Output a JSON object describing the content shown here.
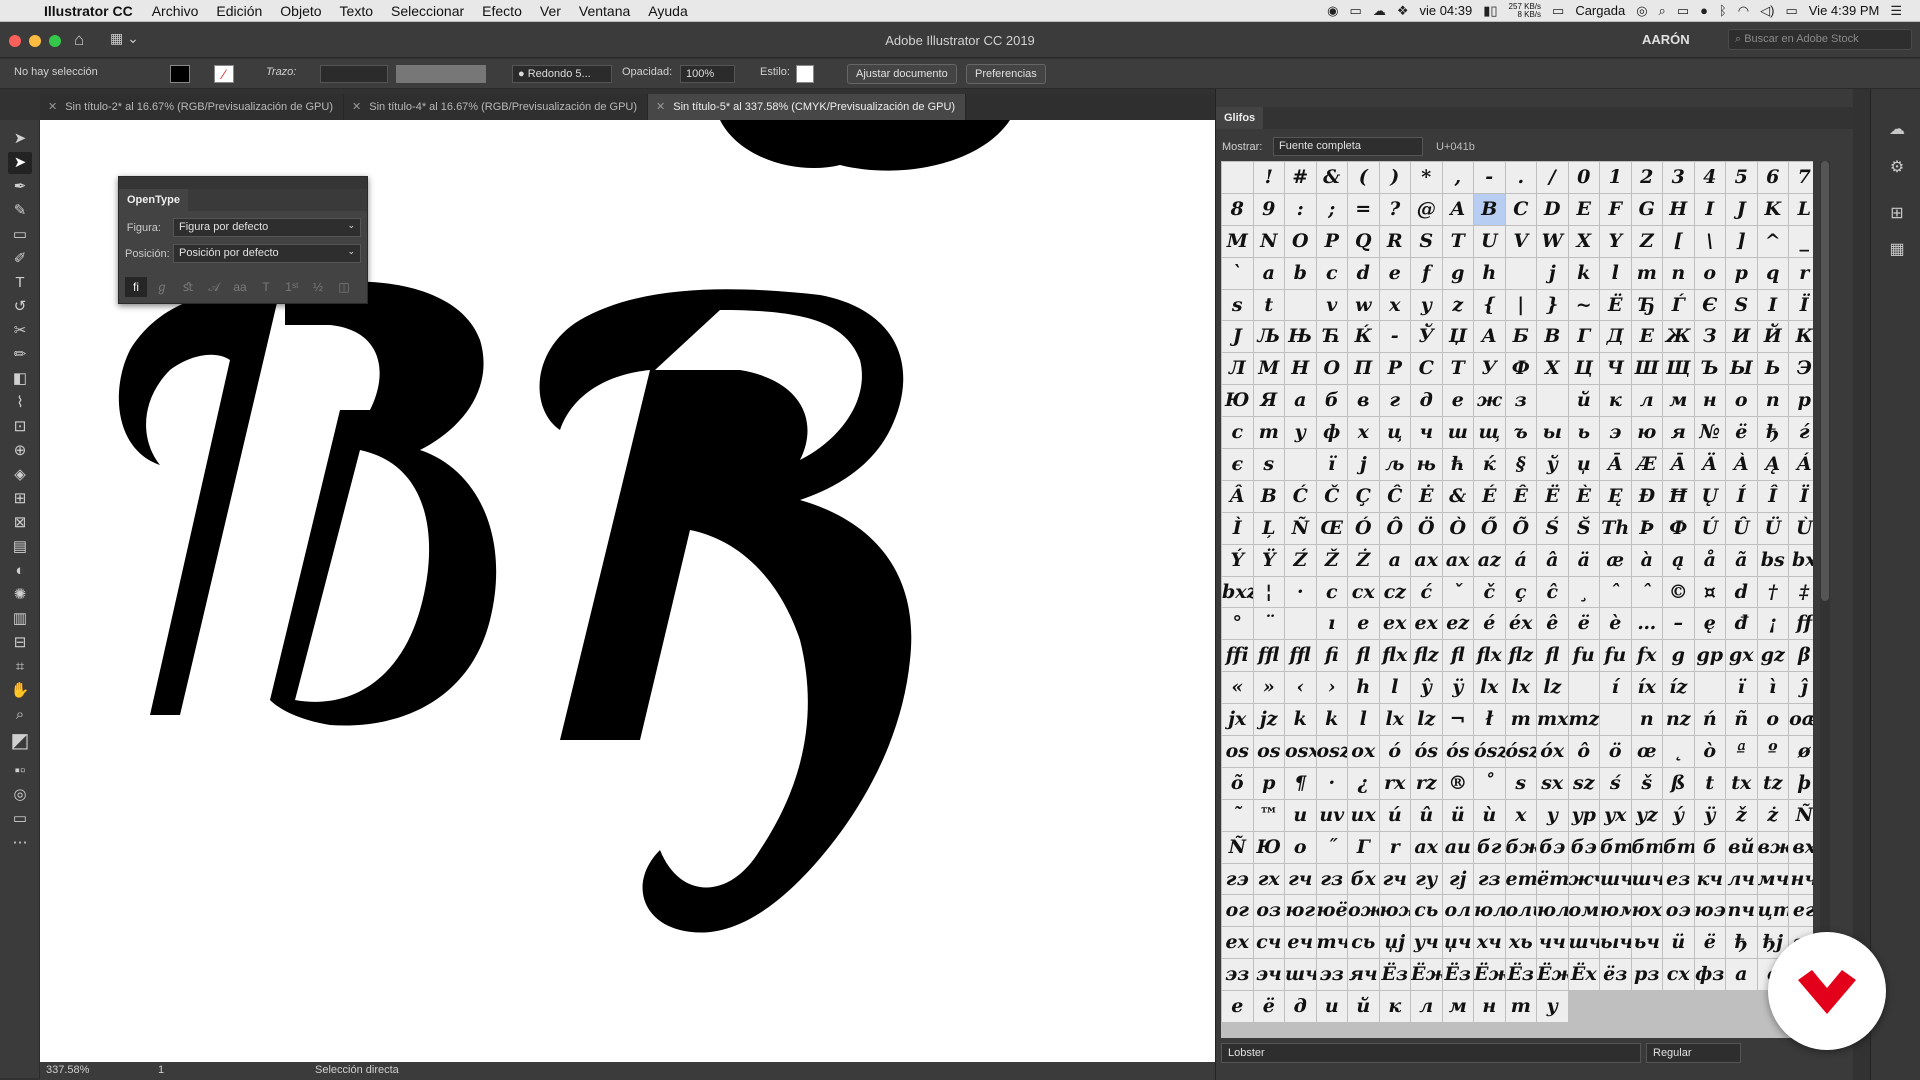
{
  "menubar": {
    "app_name": "Illustrator CC",
    "items": [
      "Archivo",
      "Edición",
      "Objeto",
      "Texto",
      "Seleccionar",
      "Efecto",
      "Ver",
      "Ventana",
      "Ayuda"
    ],
    "status_time_short": "vie 04:39",
    "net_up": "257 KB/s",
    "net_down": "8 KB/s",
    "battery_status": "Cargada",
    "clock": "Vie 4:39 PM"
  },
  "titlebar": {
    "title": "Adobe Illustrator CC 2019",
    "user": "AARÓN",
    "search_placeholder": "Buscar en Adobe Stock"
  },
  "controlbar": {
    "selection": "No hay selección",
    "trazo_label": "Trazo:",
    "brush": "Redondo 5...",
    "opacity_label": "Opacidad:",
    "opacity_value": "100%",
    "style_label": "Estilo:",
    "fit_button": "Ajustar documento",
    "prefs_button": "Preferencias"
  },
  "tabs": [
    {
      "label": "Sin título-2* al 16.67% (RGB/Previsualización de GPU)"
    },
    {
      "label": "Sin título-4* al 16.67% (RGB/Previsualización de GPU)"
    },
    {
      "label": "Sin título-5* al 337.58% (CMYK/Previsualización de GPU)"
    }
  ],
  "opentype": {
    "title": "OpenType",
    "figure_label": "Figura:",
    "figure_value": "Figura por defecto",
    "position_label": "Posición:",
    "position_value": "Posición por defecto"
  },
  "glyphs": {
    "title": "Glifos",
    "show_label": "Mostrar:",
    "show_value": "Fuente completa",
    "unicode": "U+041b",
    "font": "Lobster",
    "style": "Regular",
    "selected_index": 27,
    "cells": [
      "",
      "!",
      "#",
      "&",
      "(",
      ")",
      "*",
      ",",
      "-",
      ".",
      "/",
      "0",
      "1",
      "2",
      "3",
      "4",
      "5",
      "6",
      "7",
      "8",
      "9",
      ":",
      ";",
      "=",
      "?",
      "@",
      "A",
      "B",
      "C",
      "D",
      "E",
      "F",
      "G",
      "H",
      "I",
      "J",
      "K",
      "L",
      "M",
      "N",
      "O",
      "P",
      "Q",
      "R",
      "S",
      "T",
      "U",
      "V",
      "W",
      "X",
      "Y",
      "Z",
      "[",
      "\\",
      "]",
      "^",
      "_",
      "`",
      "a",
      "b",
      "c",
      "d",
      "e",
      "f",
      "g",
      "h",
      "",
      "j",
      "k",
      "l",
      "m",
      "n",
      "o",
      "p",
      "q",
      "r",
      "s",
      "t",
      "",
      "v",
      "w",
      "x",
      "y",
      "z",
      "{",
      "|",
      "}",
      "~",
      "Ё",
      "Ђ",
      "Ѓ",
      "Є",
      "Ѕ",
      "І",
      "Ї",
      "Ј",
      "Љ",
      "Њ",
      "Ћ",
      "Ќ",
      "-",
      "Ў",
      "Џ",
      "А",
      "Б",
      "В",
      "Г",
      "Д",
      "Е",
      "Ж",
      "З",
      "И",
      "Й",
      "К",
      "Л",
      "М",
      "Н",
      "О",
      "П",
      "Р",
      "С",
      "Т",
      "У",
      "Ф",
      "Х",
      "Ц",
      "Ч",
      "Ш",
      "Щ",
      "Ъ",
      "Ы",
      "Ь",
      "Э",
      "Ю",
      "Я",
      "а",
      "б",
      "в",
      "г",
      "д",
      "е",
      "ж",
      "з",
      "",
      "й",
      "к",
      "л",
      "м",
      "н",
      "о",
      "п",
      "р",
      "с",
      "т",
      "у",
      "ф",
      "х",
      "ц",
      "ч",
      "ш",
      "щ",
      "ъ",
      "ы",
      "ь",
      "э",
      "ю",
      "я",
      "№",
      "ё",
      "ђ",
      "ѓ",
      "є",
      "ѕ",
      "",
      "ї",
      "ј",
      "љ",
      "њ",
      "ћ",
      "ќ",
      "§",
      "ў",
      "џ",
      "Ā",
      "Æ",
      "Ā",
      "Ä",
      "À",
      "Ą",
      "Á",
      "Â",
      "B",
      "Ć",
      "Č",
      "Ç",
      "Ĉ",
      "Ė",
      "&",
      "É",
      "Ê",
      "Ë",
      "È",
      "Ę",
      "Đ",
      "Ħ",
      "Ų",
      "Í",
      "Î",
      "Ï",
      "Ì",
      "Ļ",
      "Ñ",
      "Œ",
      "Ó",
      "Ô",
      "Ö",
      "Ò",
      "Ő",
      "Õ",
      "Ś",
      "Š",
      "Th",
      "Þ",
      "Ф",
      "Ú",
      "Û",
      "Ü",
      "Ù",
      "Ý",
      "Ÿ",
      "Ź",
      "Ž",
      "Ż",
      "a",
      "ax",
      "ax",
      "az",
      "á",
      "â",
      "ä",
      "æ",
      "à",
      "ą",
      "å",
      "ã",
      "bs",
      "bx",
      "bxz",
      "¦",
      "·",
      "c",
      "cx",
      "cz",
      "ć",
      "ˇ",
      "č",
      "ç",
      "ĉ",
      "¸",
      "ˆ",
      "ˆ",
      "©",
      "¤",
      "d",
      "†",
      "‡",
      "°",
      "¨",
      "",
      "ı",
      "e",
      "ex",
      "ex",
      "ez",
      "é",
      "éx",
      "ê",
      "ë",
      "è",
      "…",
      "–",
      "ę",
      "đ",
      "¡",
      "ff",
      "ffi",
      "ffl",
      "ffl",
      "fi",
      "fl",
      "flx",
      "flz",
      "fl",
      "flx",
      "flz",
      "fl",
      "fu",
      "fu",
      "fx",
      "g",
      "gp",
      "gx",
      "gz",
      "β",
      "«",
      "»",
      "‹",
      "›",
      "h",
      "l",
      "ŷ",
      "ÿ",
      "lx",
      "lx",
      "lz",
      "",
      "í",
      "íx",
      "íz",
      "",
      "ï",
      "ì",
      "ĵ",
      "jx",
      "jz",
      "k",
      "k",
      "l",
      "lx",
      "lz",
      "¬",
      "ł",
      "m",
      "mx",
      "mz",
      "",
      "n",
      "nz",
      "ń",
      "ñ",
      "o",
      "oæ",
      "os",
      "os",
      "osx",
      "osz",
      "ox",
      "ó",
      "ós",
      "ós",
      "ósz",
      "ósz",
      "óx",
      "ô",
      "ö",
      "œ",
      "˛",
      "ò",
      "ª",
      "º",
      "ø",
      "õ",
      "p",
      "¶",
      "·",
      "¿",
      "rx",
      "rz",
      "®",
      "˚",
      "s",
      "sx",
      "sz",
      "ś",
      "š",
      "ß",
      "t",
      "tx",
      "tz",
      "þ",
      "˜",
      "™",
      "u",
      "uv",
      "ux",
      "ú",
      "û",
      "ü",
      "ù",
      "x",
      "y",
      "yp",
      "yx",
      "yz",
      "ý",
      "ÿ",
      "ž",
      "ż",
      "Ñ",
      "Ñ",
      "Ю",
      "o",
      "˝",
      "Г",
      "r",
      "ax",
      "аи",
      "бг",
      "бж",
      "бэ",
      "бэ",
      "бт",
      "бт",
      "бту",
      "б",
      "вй",
      "вж",
      "вх",
      "гэ",
      "гх",
      "гч",
      "гз",
      "бх",
      "гч",
      "гу",
      "гj",
      "гз",
      "ет",
      "ёт",
      "жч",
      "шч",
      "шч",
      "ез",
      "кч",
      "лч",
      "мч",
      "нч",
      "ог",
      "оз",
      "юг",
      "юё",
      "ожэж",
      "юж",
      "сь",
      "ол",
      "юл",
      "оль",
      "юль",
      "ом",
      "юм",
      "юх",
      "оэ",
      "юэ",
      "пч",
      "цт",
      "ег",
      "ех",
      "сч",
      "еч",
      "тч",
      "сь",
      "џј",
      "уч",
      "џч",
      "хч",
      "хь",
      "чч",
      "шч",
      "ыч",
      "ьч",
      "ü",
      "ё",
      "ђ",
      "ђј",
      "љч",
      "эз",
      "эч",
      "шч",
      "эз",
      "яч",
      "Ёз",
      "Ёж",
      "Ёз",
      "Ёж",
      "Ёз",
      "Ёж",
      "Ёх",
      "ёз",
      "рз",
      "сх",
      "фз",
      "а",
      "с",
      "ж",
      "е",
      "ё",
      "д",
      "и",
      "й",
      "к",
      "л",
      "м",
      "н",
      "т",
      "у"
    ]
  },
  "statusbar": {
    "zoom": "337.58%",
    "page": "1",
    "tool": "Selección directa"
  }
}
